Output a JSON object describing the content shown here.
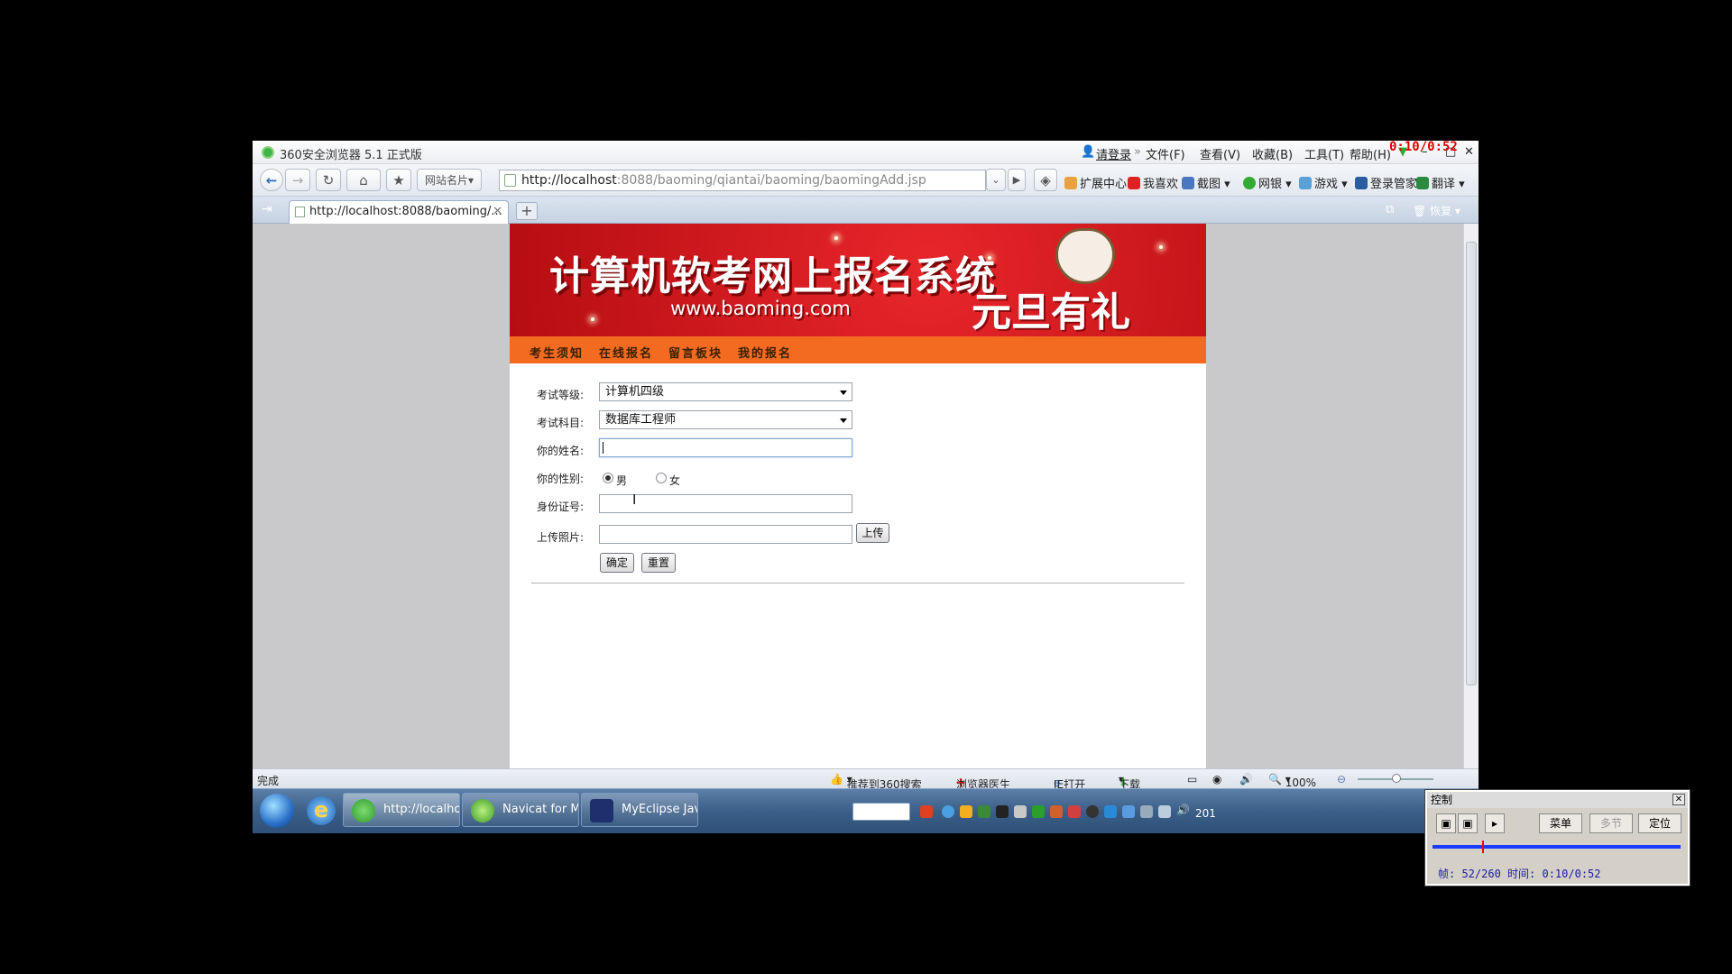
{
  "browser": {
    "title": "360安全浏览器 5.1 正式版",
    "login": "请登录",
    "menus": [
      "文件(F)",
      "查看(V)",
      "收藏(B)",
      "工具(T)",
      "帮助(H)"
    ],
    "site_names": "网站名片",
    "url_host": "http://localhost",
    "url_rest": ":8088/baoming/qiantai/baoming/baomingAdd.jsp",
    "toolbar": [
      "扩展中心",
      "我喜欢",
      "截图",
      "网银",
      "游戏",
      "登录管家",
      "翻译"
    ],
    "tab_title": "http://localhost:8088/baoming/...",
    "restore": "恢复"
  },
  "site": {
    "banner_title": "计算机软考网上报名系统",
    "banner_url": "www.baoming.com",
    "banner_promo": "元旦有礼",
    "nav": [
      "考生须知",
      "在线报名",
      "留言板块",
      "我的报名"
    ]
  },
  "form": {
    "level_label": "考试等级:",
    "level_value": "计算机四级",
    "subject_label": "考试科目:",
    "subject_value": "数据库工程师",
    "name_label": "你的姓名:",
    "gender_label": "你的性别:",
    "gender_male": "男",
    "gender_female": "女",
    "id_label": "身份证号:",
    "photo_label": "上传照片:",
    "upload_btn": "上传",
    "submit_btn": "确定",
    "reset_btn": "重置"
  },
  "status": {
    "text": "完成",
    "recommend": "推荐到360搜索",
    "doctor": "浏览器医生",
    "ie_open": "IE打开",
    "download": "下载",
    "zoom": "100%"
  },
  "taskbar": {
    "tasks": [
      "http://localhost...",
      "Navicat for MyS...",
      "MyEclipse Java ..."
    ],
    "clock": "201"
  },
  "recorder": {
    "timer": "0:10/0:52",
    "title": "控制",
    "menu_btn": "菜单",
    "multi_btn": "多节",
    "locate_btn": "定位",
    "info": "帧: 52/260 时间: 0:10/0:52",
    "progress": 0.2
  },
  "colors": {
    "banner_red": "#c8141a",
    "nav_orange": "#f36b21"
  }
}
